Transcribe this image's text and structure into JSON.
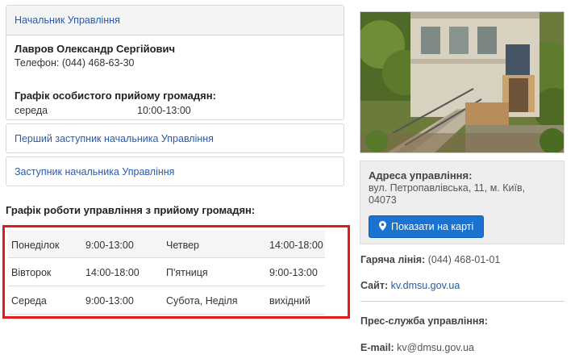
{
  "chief": {
    "header": "Начальник Управління",
    "name": "Лавров Олександр Сергійович",
    "phone_label": "Телефон:",
    "phone": "(044) 468-63-30",
    "schedule_title": "Графік особистого прийому громадян:",
    "schedule_day": "середа",
    "schedule_time": "10:00-13:00"
  },
  "deputies": {
    "first": "Перший заступник начальника Управління",
    "second": "Заступник начальника Управління"
  },
  "hours": {
    "title": "Графік роботи управління з прийому громадян:",
    "rows": [
      {
        "d1": "Понеділок",
        "t1": "9:00-13:00",
        "d2": "Четвер",
        "t2": "14:00-18:00"
      },
      {
        "d1": "Вівторок",
        "t1": "14:00-18:00",
        "d2": "П'ятниця",
        "t2": "9:00-13:00"
      },
      {
        "d1": "Середа",
        "t1": "9:00-13:00",
        "d2": "Субота, Неділя",
        "t2": "вихідний"
      }
    ]
  },
  "sidebar": {
    "address_label": "Адреса управління:",
    "address": "вул. Петропавлівська, 11, м. Київ, 04073",
    "map_button": "Показати на карті",
    "hotline_label": "Гаряча лінія:",
    "hotline": "(044) 468-01-01",
    "site_label": "Сайт:",
    "site": "kv.dmsu.gov.ua",
    "press_label": "Прес-служба управління:",
    "email_label": "E-mail:",
    "email": "kv@dmsu.gov.ua"
  },
  "icons": {
    "map_button": "map-marker-icon"
  },
  "colors": {
    "highlight_border": "#e11b1b",
    "button": "#1b73d1",
    "link": "#2a5ba8"
  }
}
